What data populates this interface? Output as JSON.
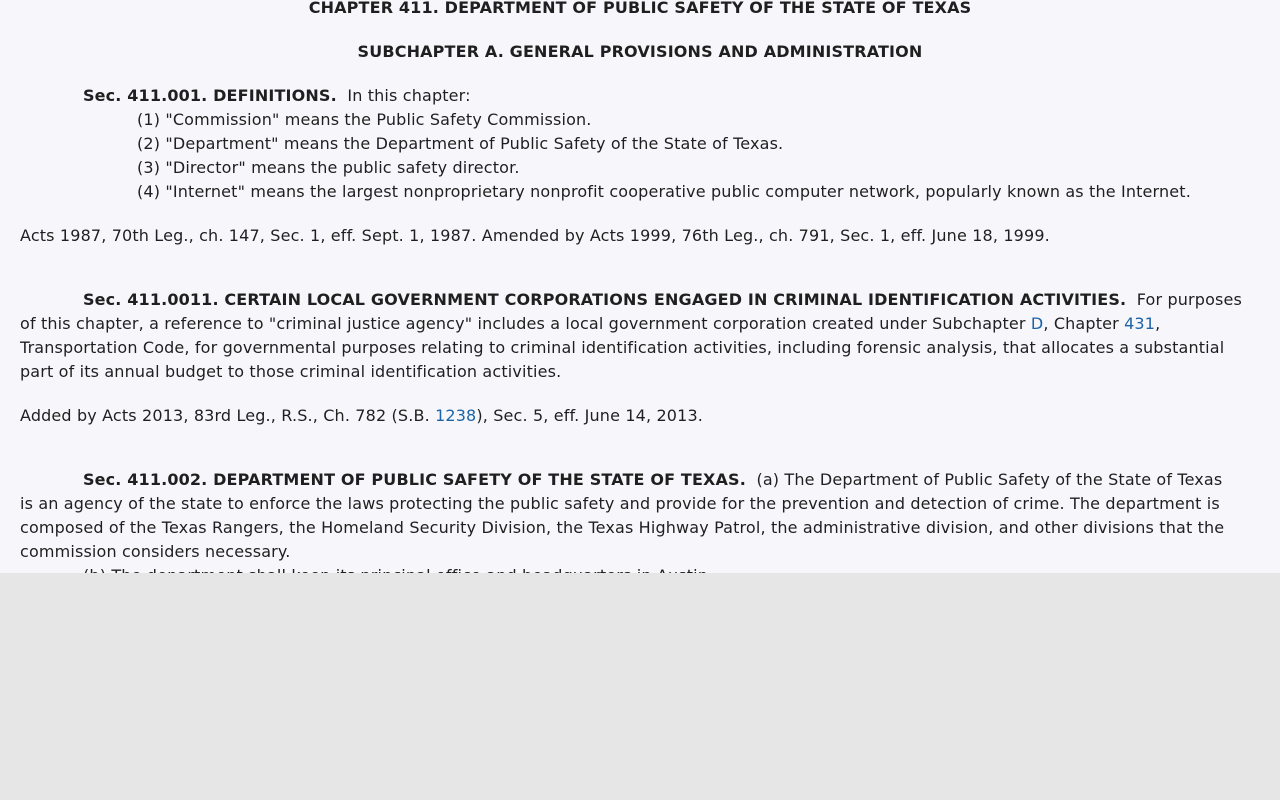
{
  "chapter_title": "CHAPTER 411. DEPARTMENT OF PUBLIC SAFETY OF THE STATE OF TEXAS",
  "subchapter_title": "SUBCHAPTER A. GENERAL PROVISIONS AND ADMINISTRATION",
  "sec_001": {
    "heading": "Sec. 411.001.  DEFINITIONS.",
    "intro": "In this chapter:",
    "items": [
      "(1)  \"Commission\" means the Public Safety Commission.",
      "(2)  \"Department\" means the Department of Public Safety of the State of Texas.",
      "(3)  \"Director\" means the public safety director.",
      "(4)  \"Internet\" means the largest nonproprietary nonprofit cooperative public computer network, popularly known as the Internet."
    ],
    "history": "Acts 1987, 70th Leg., ch. 147, Sec. 1, eff. Sept. 1, 1987.  Amended by Acts 1999, 76th Leg., ch. 791, Sec. 1, eff. June 18, 1999."
  },
  "sec_0011": {
    "heading": "Sec. 411.0011.  CERTAIN LOCAL GOVERNMENT CORPORATIONS ENGAGED IN CRIMINAL IDENTIFICATION ACTIVITIES.",
    "line1_tail": "For purposes",
    "line2_a": "of this chapter, a reference to \"criminal justice agency\" includes a local government corporation created under Subchapter ",
    "link_subchapter": "D",
    "line2_b": ", Chapter ",
    "link_chapter": "431",
    "line2_c": ",",
    "line3": "Transportation Code, for governmental purposes relating to criminal identification activities, including forensic analysis, that allocates a substantial",
    "line4": "part of its annual budget to those criminal identification activities.",
    "history_a": "Added by Acts 2013, 83rd Leg., R.S., Ch. 782 (S.B. ",
    "history_link": "1238",
    "history_b": "), Sec. 5, eff. June 14, 2013."
  },
  "sec_002": {
    "heading": "Sec. 411.002.  DEPARTMENT OF PUBLIC SAFETY OF THE STATE OF TEXAS.",
    "line1_tail": "(a)  The Department of Public Safety of the State of Texas",
    "line2": "is an agency of the state to enforce the laws protecting the public safety and provide for the prevention and detection of crime.  The department is",
    "line3": "composed of the Texas Rangers, the Homeland Security Division, the Texas Highway Patrol, the administrative division, and other divisions that the",
    "line4": "commission considers necessary.",
    "line5_partial": "(b)  The department shall keep its principal office and headquarters in Austin."
  }
}
